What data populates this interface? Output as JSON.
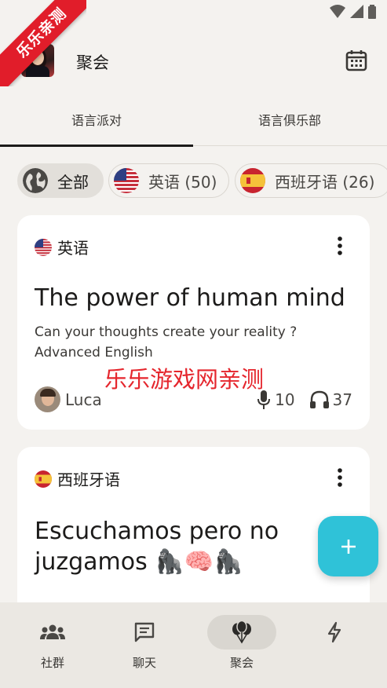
{
  "watermark_corner": "乐乐亲测",
  "header": {
    "title": "聚会"
  },
  "tabs": [
    {
      "label": "语言派对",
      "active": true
    },
    {
      "label": "语言俱乐部",
      "active": false
    }
  ],
  "filters": [
    {
      "label": "全部",
      "icon": "globe-icon",
      "active": true
    },
    {
      "label": "英语 (50)",
      "icon": "us-flag-icon",
      "active": false
    },
    {
      "label": "西班牙语 (26)",
      "icon": "spain-flag-icon",
      "active": false
    }
  ],
  "cards": [
    {
      "language": "英语",
      "title": "The power of human mind",
      "description": "Can your thoughts  create your reality ? Advanced English",
      "host": "Luca",
      "speakers": "10",
      "listeners": "37"
    },
    {
      "language": "西班牙语",
      "title": "Escuchamos pero no juzgamos 🦍🧠🦍"
    }
  ],
  "watermark_center": "乐乐游戏网亲测",
  "bottom_nav": [
    {
      "label": "社群",
      "icon": "community-icon",
      "active": false
    },
    {
      "label": "聊天",
      "icon": "chat-icon",
      "active": false
    },
    {
      "label": "聚会",
      "icon": "balloons-icon",
      "active": true
    },
    {
      "label": "",
      "icon": "lightning-icon",
      "active": false
    }
  ],
  "colors": {
    "accent": "#2fc2d8",
    "watermark": "#e5262d",
    "ribbon": "#e11d2a"
  }
}
